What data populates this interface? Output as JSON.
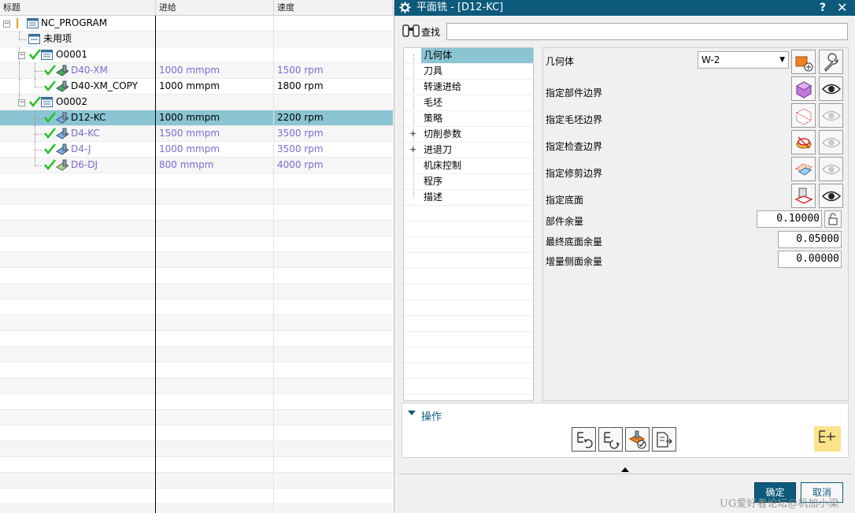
{
  "navigator": {
    "columns": [
      "标题",
      "进给",
      "速度"
    ],
    "rows": [
      {
        "name": "NC_PROGRAM",
        "feed": "",
        "speed": "",
        "kind": "root"
      },
      {
        "name": "未用项",
        "feed": "",
        "speed": "",
        "kind": "folder"
      },
      {
        "name": "O0001",
        "feed": "",
        "speed": "",
        "kind": "group",
        "checked": true
      },
      {
        "name": "D40-XM",
        "feed": "1000 mmpm",
        "speed": "1500 rpm",
        "kind": "op",
        "checked": true,
        "muted": true
      },
      {
        "name": "D40-XM_COPY",
        "feed": "1000 mmpm",
        "speed": "1800 rpm",
        "kind": "op",
        "checked": true,
        "muted": false
      },
      {
        "name": "O0002",
        "feed": "",
        "speed": "",
        "kind": "group",
        "checked": true
      },
      {
        "name": "D12-KC",
        "feed": "1000 mmpm",
        "speed": "2200 rpm",
        "kind": "op",
        "checked": true,
        "muted": false,
        "selected": true
      },
      {
        "name": "D4-KC",
        "feed": "1500 mmpm",
        "speed": "3500 rpm",
        "kind": "op",
        "checked": true,
        "muted": true
      },
      {
        "name": "D4-J",
        "feed": "1000 mmpm",
        "speed": "3500 rpm",
        "kind": "op",
        "checked": true,
        "muted": true
      },
      {
        "name": "D6-DJ",
        "feed": "800 mmpm",
        "speed": "4000 rpm",
        "kind": "op",
        "checked": true,
        "muted": true
      }
    ]
  },
  "dialog": {
    "title": "平面铣 - [D12-KC]",
    "help": "?",
    "close": "✕",
    "find": {
      "label": "查找",
      "value": ""
    },
    "categories": [
      {
        "label": "几何体",
        "selected": true,
        "expandable": false
      },
      {
        "label": "刀具",
        "selected": false,
        "expandable": false
      },
      {
        "label": "转速进给",
        "selected": false,
        "expandable": false
      },
      {
        "label": "毛坯",
        "selected": false,
        "expandable": false
      },
      {
        "label": "策略",
        "selected": false,
        "expandable": false
      },
      {
        "label": "切削参数",
        "selected": false,
        "expandable": true
      },
      {
        "label": "进退刀",
        "selected": false,
        "expandable": true
      },
      {
        "label": "机床控制",
        "selected": false,
        "expandable": false
      },
      {
        "label": "程序",
        "selected": false,
        "expandable": false
      },
      {
        "label": "描述",
        "selected": false,
        "expandable": false
      }
    ],
    "geometry": {
      "label": "几何体",
      "value": "W-2",
      "part_boundary": "指定部件边界",
      "blank_boundary": "指定毛坯边界",
      "check_boundary": "指定检查边界",
      "trim_boundary": "指定修剪边界",
      "floor": "指定底面",
      "part_stock_label": "部件余量",
      "part_stock": "0.10000",
      "final_floor_stock_label": "最终底面余量",
      "final_floor_stock": "0.05000",
      "side_stock_inc_label": "增量侧面余量",
      "side_stock_inc": "0.00000"
    },
    "operations": {
      "title": "操作"
    },
    "ok": "确定",
    "cancel": "取消"
  },
  "watermark": "UG爱好者论坛@机加小梁",
  "colors": {
    "accent": "#0d5a7c",
    "selection": "#8bc4d3",
    "muted_text": "#7b6bd6",
    "check": "#22c022"
  }
}
